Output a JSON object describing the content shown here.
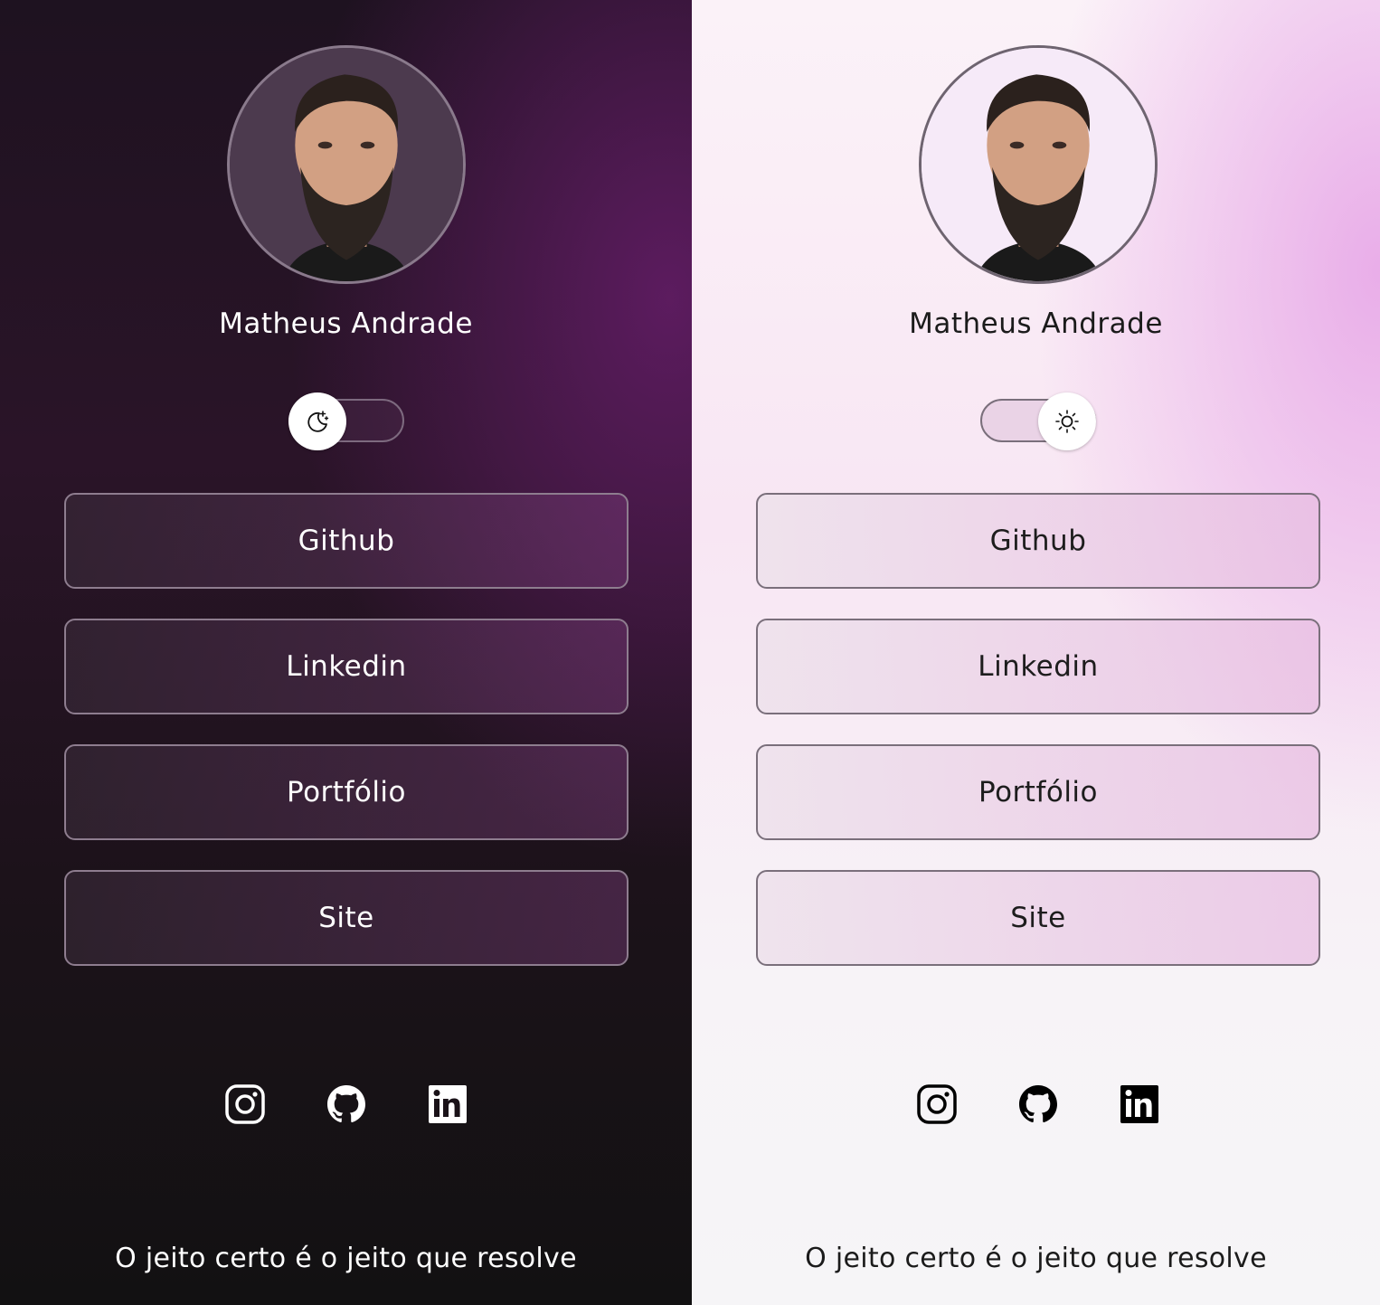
{
  "profiles": [
    {
      "theme": "dark",
      "name": "Matheus Andrade",
      "avatar": {
        "alt": "profile photo"
      },
      "toggle": {
        "state": "dark",
        "icon": "moon-icon"
      },
      "links": [
        {
          "label": "Github"
        },
        {
          "label": "Linkedin"
        },
        {
          "label": "Portfólio"
        },
        {
          "label": "Site"
        }
      ],
      "social": [
        {
          "icon": "instagram-icon"
        },
        {
          "icon": "github-icon"
        },
        {
          "icon": "linkedin-icon"
        }
      ],
      "motto": "O jeito certo é o jeito que resolve",
      "colors": {
        "background_accent": "#5f1c62",
        "text": "#ffffff"
      }
    },
    {
      "theme": "light",
      "name": "Matheus Andrade",
      "avatar": {
        "alt": "profile photo"
      },
      "toggle": {
        "state": "light",
        "icon": "sun-icon"
      },
      "links": [
        {
          "label": "Github"
        },
        {
          "label": "Linkedin"
        },
        {
          "label": "Portfólio"
        },
        {
          "label": "Site"
        }
      ],
      "social": [
        {
          "icon": "instagram-icon"
        },
        {
          "icon": "github-icon"
        },
        {
          "icon": "linkedin-icon"
        }
      ],
      "motto": "O jeito certo é o jeito que resolve",
      "colors": {
        "background_accent": "#e8aae8",
        "text": "#1b1b1b"
      }
    }
  ]
}
